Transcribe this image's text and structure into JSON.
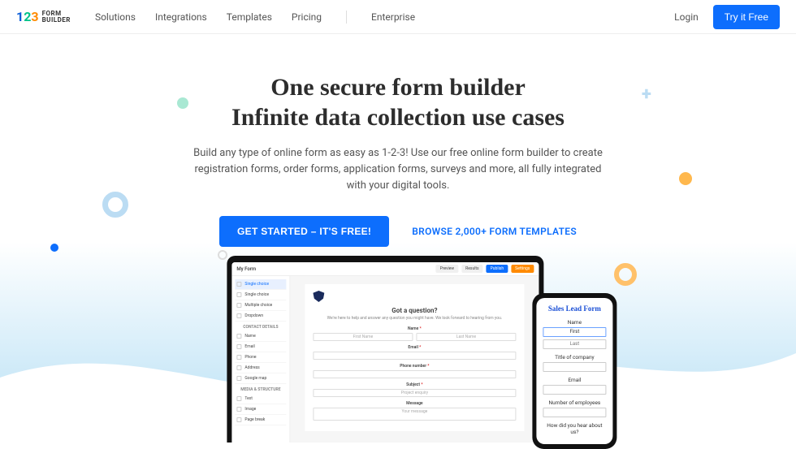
{
  "brand": {
    "name": "FORM\nBUILDER"
  },
  "nav": {
    "solutions": "Solutions",
    "integrations": "Integrations",
    "templates": "Templates",
    "pricing": "Pricing",
    "enterprise": "Enterprise"
  },
  "header_right": {
    "login": "Login",
    "try_free": "Try it Free"
  },
  "hero": {
    "title_line1": "One secure form builder",
    "title_line2": "Infinite data collection use cases",
    "subtitle": "Build any type of online form as easy as 1-2-3! Use our free online form builder to create registration forms, order forms, application forms, surveys and more, all fully integrated with your digital tools.",
    "cta_primary": "GET STARTED – IT'S FREE!",
    "cta_secondary": "BROWSE 2,000+ FORM TEMPLATES"
  },
  "app": {
    "title": "My Form",
    "preview": "Preview",
    "results": "Results",
    "publish": "Publish",
    "settings": "Settings",
    "sidebar": {
      "active": "Single choice",
      "items_choices": [
        "Single choice",
        "Multiple choice",
        "Dropdown"
      ],
      "heading_contact": "CONTACT DETAILS",
      "items_contact": [
        "Name",
        "Email",
        "Phone",
        "Address",
        "Google map"
      ],
      "heading_media": "MEDIA & STRUCTURE",
      "items_media": [
        "Text",
        "Image",
        "Page break"
      ]
    },
    "form": {
      "title": "Got a question?",
      "subtitle": "We're here to help and answer any question you might have. We look forward to hearing from you.",
      "name": "Name",
      "first_name": "First Name",
      "last_name": "Last Name",
      "email": "Email",
      "phone": "Phone number",
      "subject": "Subject",
      "subject_value": "Project enquiry",
      "message": "Message",
      "message_ph": "Your message"
    }
  },
  "phone": {
    "title": "Sales Lead Form",
    "name": "Name",
    "name_first": "First",
    "name_last": "Last",
    "company": "Title of company",
    "email": "Email",
    "employees": "Number of employees",
    "how": "How did you hear about us?"
  }
}
